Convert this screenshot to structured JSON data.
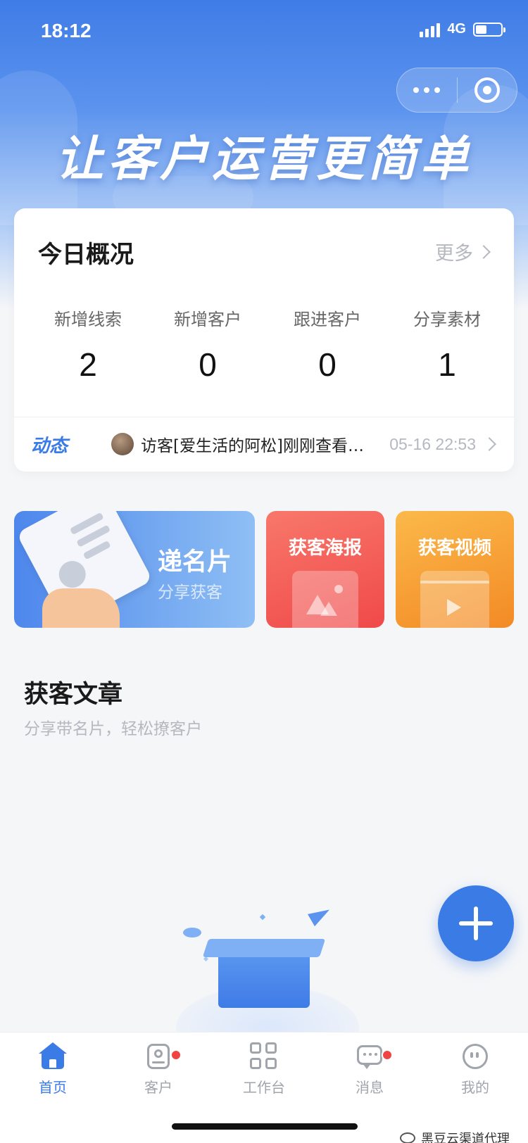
{
  "status_bar": {
    "time": "18:12",
    "network": "4G",
    "battery_level": 0.45
  },
  "banner": {
    "slogan": "让客户运营更简单"
  },
  "overview": {
    "title": "今日概况",
    "more_label": "更多",
    "stats": [
      {
        "label": "新增线索",
        "value": "2"
      },
      {
        "label": "新增客户",
        "value": "0"
      },
      {
        "label": "跟进客户",
        "value": "0"
      },
      {
        "label": "分享素材",
        "value": "1"
      }
    ],
    "feed": {
      "tag": "动态",
      "text": "访客[爱生活的阿松]刚刚查看…",
      "time": "05-16 22:53"
    }
  },
  "quick_actions": {
    "card": {
      "title": "递名片",
      "subtitle": "分享获客"
    },
    "poster": {
      "title": "获客海报"
    },
    "video": {
      "title": "获客视频"
    }
  },
  "articles": {
    "title": "获客文章",
    "subtitle": "分享带名片，轻松撩客户"
  },
  "tabbar": {
    "items": [
      {
        "label": "首页",
        "icon": "home-icon",
        "active": true,
        "badge": false
      },
      {
        "label": "客户",
        "icon": "customer-icon",
        "active": false,
        "badge": true
      },
      {
        "label": "工作台",
        "icon": "workbench-icon",
        "active": false,
        "badge": false
      },
      {
        "label": "消息",
        "icon": "message-icon",
        "active": false,
        "badge": true
      },
      {
        "label": "我的",
        "icon": "profile-icon",
        "active": false,
        "badge": false
      }
    ]
  },
  "watermark": {
    "text": "黑豆云渠道代理"
  },
  "colors": {
    "primary": "#3b7be6",
    "badge": "#ee4444",
    "poster": "#f0494a",
    "video": "#f38a25"
  }
}
